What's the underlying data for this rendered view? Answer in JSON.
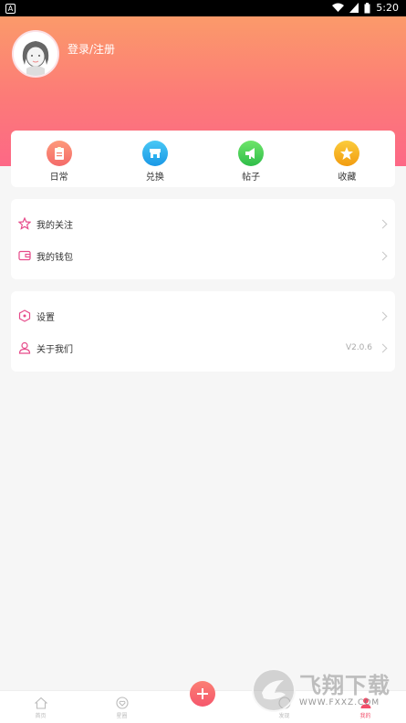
{
  "status_bar": {
    "notif": "A",
    "time": "5:20"
  },
  "profile": {
    "login_text": "登录/注册"
  },
  "quick_actions": [
    {
      "label": "日常",
      "icon": "clipboard-icon",
      "color": "#f7736a"
    },
    {
      "label": "兑换",
      "icon": "store-icon",
      "color": "#2ab1f0"
    },
    {
      "label": "帖子",
      "icon": "megaphone-icon",
      "color": "#4fd14e"
    },
    {
      "label": "收藏",
      "icon": "star-icon",
      "color": "#f7b31f"
    }
  ],
  "menu_group1": [
    {
      "label": "我的关注",
      "icon": "star-outline-icon"
    },
    {
      "label": "我的钱包",
      "icon": "wallet-icon"
    }
  ],
  "menu_group2": [
    {
      "label": "设置",
      "icon": "hexagon-settings-icon"
    },
    {
      "label": "关于我们",
      "icon": "person-icon",
      "version": "V2.0.6"
    }
  ],
  "tabbar": [
    {
      "label": "首页",
      "icon": "home-icon"
    },
    {
      "label": "星圈",
      "icon": "heart-circle-icon"
    },
    {
      "label": "",
      "icon": "plus-icon"
    },
    {
      "label": "发现",
      "icon": "compass-icon"
    },
    {
      "label": "我的",
      "icon": "user-icon",
      "active": true
    }
  ],
  "watermark": {
    "text": "飞翔下载",
    "url": "WWW.FXXZ.COM"
  },
  "colors": {
    "accent": "#f24f6a",
    "header_top": "#fb9a6a",
    "header_bottom": "#fd6886"
  }
}
